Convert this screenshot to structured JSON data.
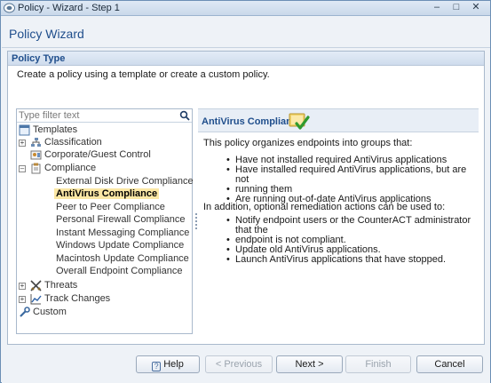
{
  "window": {
    "title": "Policy - Wizard - Step 1",
    "controls": {
      "minimize": "–",
      "maximize": "□",
      "close": "✕"
    }
  },
  "header": {
    "title": "Policy Wizard"
  },
  "section": {
    "title": "Policy Type",
    "description": "Create a policy using a template or create a custom policy."
  },
  "filter": {
    "placeholder": "Type filter text",
    "value": ""
  },
  "tree": {
    "root": "Templates",
    "classification": "Classification",
    "corporate": "Corporate/Guest Control",
    "compliance": "Compliance",
    "compliance_children": [
      "External Disk Drive Compliance",
      "AntiVirus Compliance",
      "Peer to Peer Compliance",
      "Personal Firewall Compliance",
      "Instant Messaging Compliance",
      "Windows Update Compliance",
      "Macintosh Update Compliance",
      "Overall Endpoint Compliance"
    ],
    "threats": "Threats",
    "track_changes": "Track Changes",
    "custom": "Custom",
    "selected": "AntiVirus Compliance"
  },
  "detail": {
    "title": "AntiVirus Compliance",
    "intro": "This policy organizes endpoints into groups that:",
    "groups": [
      "Have not installed required AntiVirus applications",
      "Have installed required AntiVirus applications, but are not",
      "running them",
      "Are running out-of-date AntiVirus applications"
    ],
    "remediation_intro": "In addition, optional remediation actions can be used to:",
    "actions": [
      "Notify endpoint users or the CounterACT administrator that the",
      "endpoint is not compliant.",
      "Update old AntiVirus applications.",
      "Launch AntiVirus applications that have stopped."
    ]
  },
  "buttons": {
    "help": "Help",
    "previous": "< Previous",
    "next": "Next >",
    "finish": "Finish",
    "cancel": "Cancel"
  },
  "colors": {
    "accent": "#1f4e8c",
    "selection": "#fbe7a5",
    "check": "#3aa63a"
  }
}
